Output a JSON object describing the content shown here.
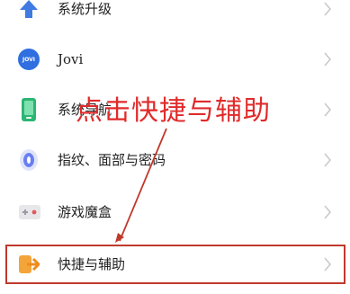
{
  "settings": {
    "items": [
      {
        "label": "系统升级",
        "icon": "upgrade-arrow-icon"
      },
      {
        "label": "Jovi",
        "icon": "jovi-icon",
        "icon_text": "JOVI"
      },
      {
        "label": "系统导航",
        "icon": "phone-navigation-icon"
      },
      {
        "label": "指纹、面部与密码",
        "icon": "fingerprint-icon"
      },
      {
        "label": "游戏魔盒",
        "icon": "game-box-icon"
      },
      {
        "label": "快捷与辅助",
        "icon": "shortcut-arrow-icon"
      }
    ]
  },
  "annotation": {
    "text": "点击快捷与辅助",
    "color": "#e02b2b"
  },
  "colors": {
    "highlight_border": "#c0392b",
    "chevron": "#c9c9c9"
  }
}
